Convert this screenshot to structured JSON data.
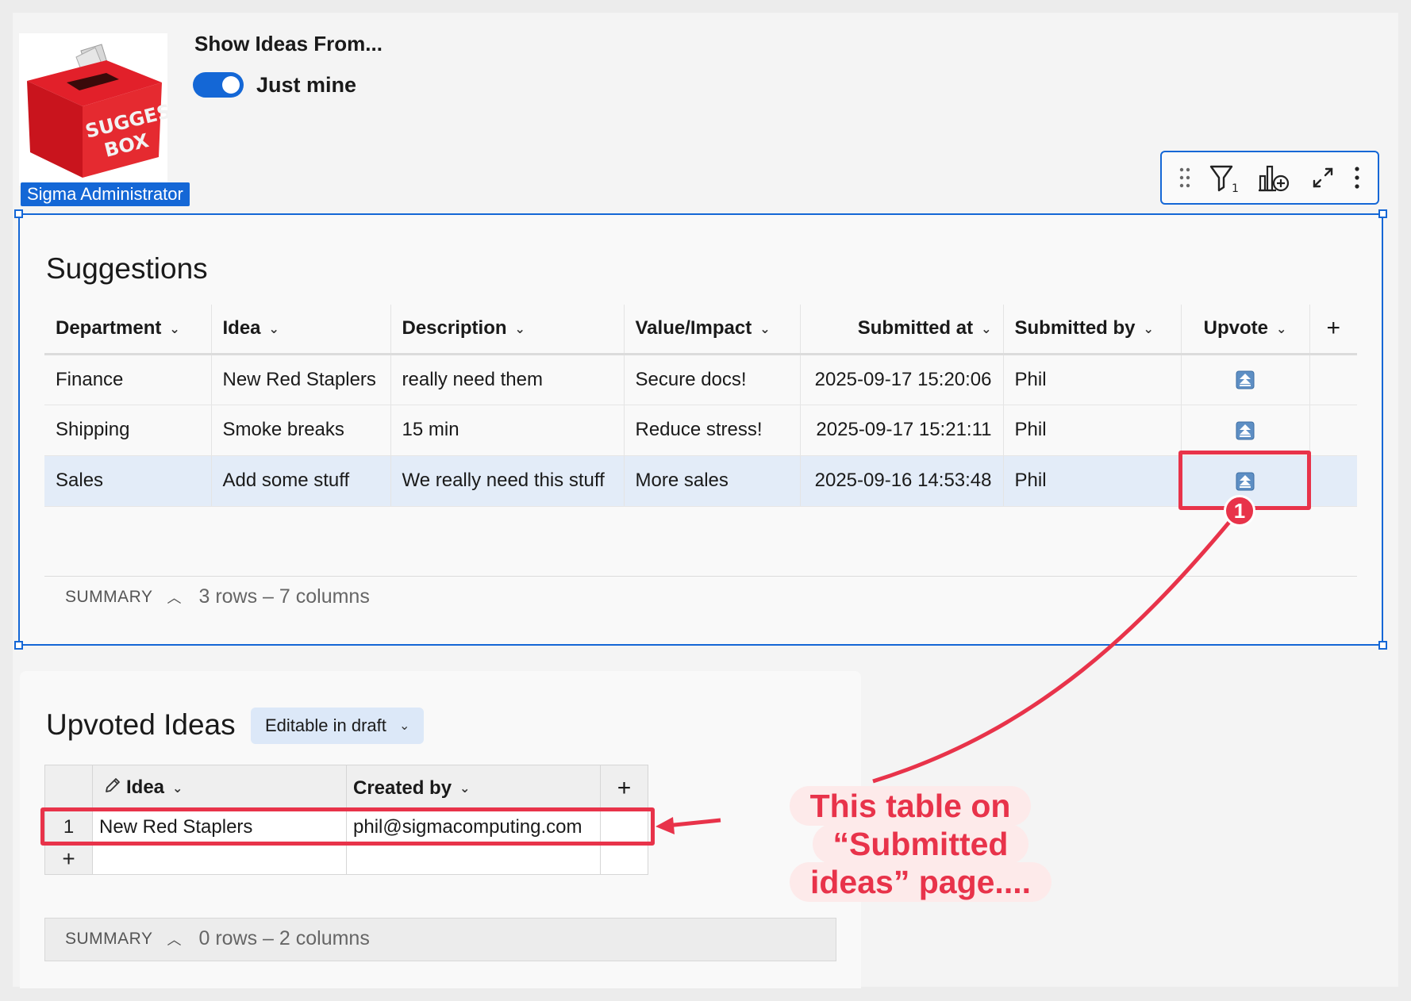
{
  "header": {
    "title": "Show Ideas From...",
    "toggle_label": "Just mine",
    "toggle_on": true,
    "user_badge": "Sigma Administrator",
    "logo_text_line1": "SUGGESTION",
    "logo_text_line2": "BOX"
  },
  "toolbar": {
    "icons": [
      "drag-handle-icon",
      "filter-icon",
      "add-chart-icon",
      "expand-icon",
      "more-menu-icon"
    ],
    "filter_count": "1"
  },
  "suggestions": {
    "title": "Suggestions",
    "columns": [
      "Department",
      "Idea",
      "Description",
      "Value/Impact",
      "Submitted at",
      "Submitted by",
      "Upvote"
    ],
    "add_column": "+",
    "rows": [
      {
        "department": "Finance",
        "idea": "New Red Staplers",
        "description": "really need them",
        "value": "Secure docs!",
        "submitted_at": "2025-09-17 15:20:06",
        "submitted_by": "Phil"
      },
      {
        "department": "Shipping",
        "idea": "Smoke breaks",
        "description": "15 min",
        "value": "Reduce stress!",
        "submitted_at": "2025-09-17 15:21:11",
        "submitted_by": "Phil"
      },
      {
        "department": "Sales",
        "idea": "Add some stuff",
        "description": "We really need this stuff",
        "value": "More sales",
        "submitted_at": "2025-09-16 14:53:48",
        "submitted_by": "Phil"
      }
    ],
    "summary_label": "SUMMARY",
    "summary_text": "3 rows – 7 columns"
  },
  "upvoted": {
    "title": "Upvoted Ideas",
    "mode_button": "Editable in draft",
    "columns": [
      "Idea",
      "Created by"
    ],
    "add_column": "+",
    "rows": [
      {
        "num": "1",
        "idea": "New Red Staplers",
        "created_by": "phil@sigmacomputing.com"
      }
    ],
    "add_row": "+",
    "summary_label": "SUMMARY",
    "summary_text": "0 rows – 2 columns"
  },
  "annotation": {
    "badge": "1",
    "callout_line1": "This table on “Submitted",
    "callout_line2": "ideas” page....",
    "color": "#e8334a"
  },
  "colors": {
    "accent": "#1467d6",
    "selected_row": "#e3ecf8",
    "annotation": "#e8334a"
  }
}
